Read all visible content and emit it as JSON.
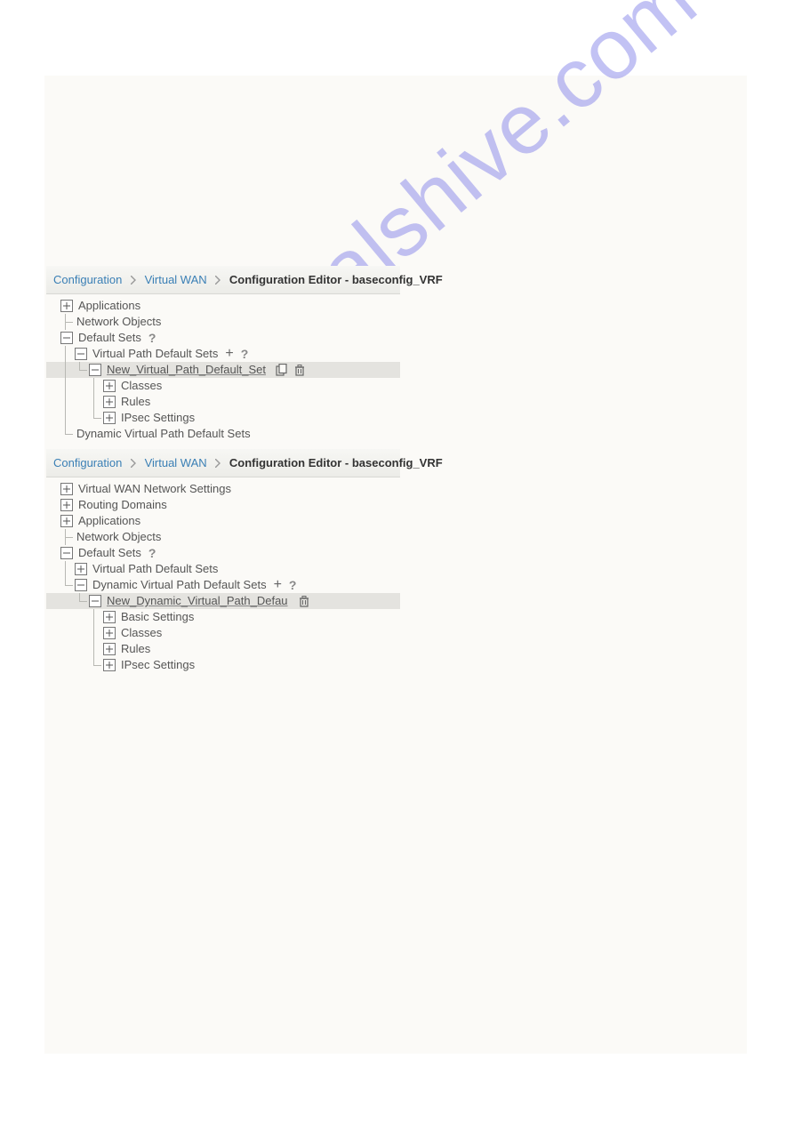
{
  "watermark": "manualshive.com",
  "breadcrumb": {
    "link1": "Configuration",
    "link2": "Virtual WAN",
    "current": "Configuration Editor - baseconfig_VRF"
  },
  "panel1": {
    "tree": {
      "applications": "Applications",
      "network_objects": "Network Objects",
      "default_sets": "Default Sets",
      "vp_default_sets": "Virtual Path Default Sets",
      "new_vp": "New_Virtual_Path_Default_Set",
      "classes": "Classes",
      "rules": "Rules",
      "ipsec": "IPsec Settings",
      "dvp_default_sets": "Dynamic Virtual Path Default Sets"
    }
  },
  "panel2": {
    "tree": {
      "vwan_net": "Virtual WAN Network Settings",
      "routing_domains": "Routing Domains",
      "applications": "Applications",
      "network_objects": "Network Objects",
      "default_sets": "Default Sets",
      "vp_default_sets": "Virtual Path Default Sets",
      "dvp_default_sets": "Dynamic Virtual Path Default Sets",
      "new_dvp": "New_Dynamic_Virtual_Path_Defau",
      "basic": "Basic Settings",
      "classes": "Classes",
      "rules": "Rules",
      "ipsec": "IPsec Settings"
    }
  }
}
